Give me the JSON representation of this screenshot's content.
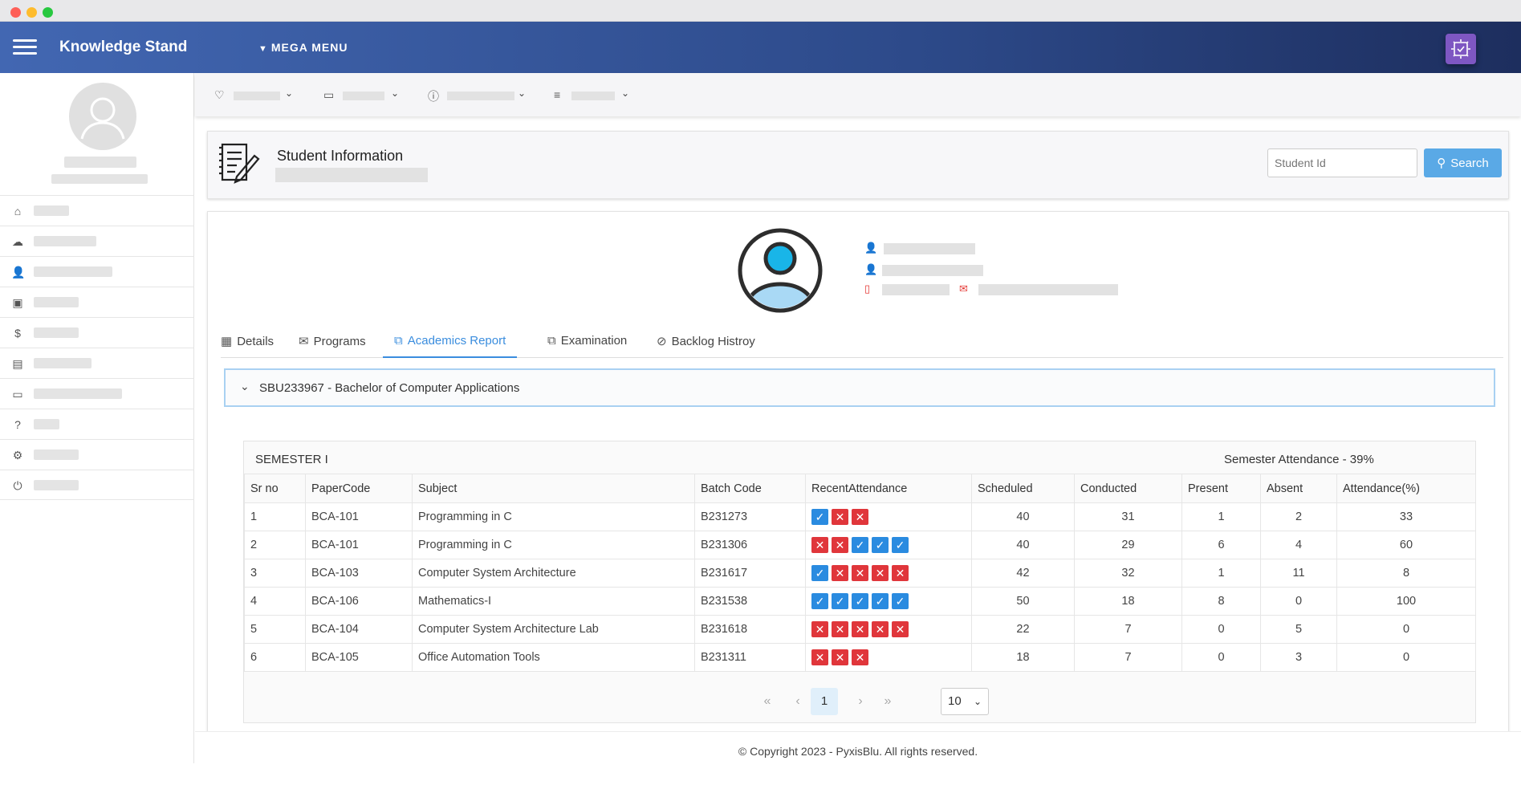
{
  "app": {
    "brand": "Knowledge Stand",
    "mega_menu": "MEGA MENU"
  },
  "header": {
    "title": "Student Information",
    "search_placeholder": "Student Id",
    "search_label": "Search"
  },
  "tabs": [
    {
      "label": "Details",
      "icon": "calendar-icon"
    },
    {
      "label": "Programs",
      "icon": "inbox-icon"
    },
    {
      "label": "Academics Report",
      "icon": "copy-icon",
      "active": true
    },
    {
      "label": "Examination",
      "icon": "copy-icon"
    },
    {
      "label": "Backlog Histroy",
      "icon": "block-icon"
    }
  ],
  "program": {
    "label": "SBU233967 - Bachelor of Computer Applications"
  },
  "semester": {
    "title": "SEMESTER I",
    "attendance": "Semester Attendance - 39%",
    "columns": [
      "Sr no",
      "PaperCode",
      "Subject",
      "Batch Code",
      "RecentAttendance",
      "Scheduled",
      "Conducted",
      "Present",
      "Absent",
      "Attendance(%)"
    ],
    "rows": [
      {
        "sr": "1",
        "code": "BCA-101",
        "subject": "Programming in C",
        "batch": "B231273",
        "recent": [
          "P",
          "A",
          "A"
        ],
        "scheduled": "40",
        "conducted": "31",
        "present": "1",
        "absent": "2",
        "percent": "33"
      },
      {
        "sr": "2",
        "code": "BCA-101",
        "subject": "Programming in C",
        "batch": "B231306",
        "recent": [
          "A",
          "A",
          "P",
          "P",
          "P"
        ],
        "scheduled": "40",
        "conducted": "29",
        "present": "6",
        "absent": "4",
        "percent": "60"
      },
      {
        "sr": "3",
        "code": "BCA-103",
        "subject": "Computer System Architecture",
        "batch": "B231617",
        "recent": [
          "P",
          "A",
          "A",
          "A",
          "A"
        ],
        "scheduled": "42",
        "conducted": "32",
        "present": "1",
        "absent": "11",
        "percent": "8"
      },
      {
        "sr": "4",
        "code": "BCA-106",
        "subject": "Mathematics-I",
        "batch": "B231538",
        "recent": [
          "P",
          "P",
          "P",
          "P",
          "P"
        ],
        "scheduled": "50",
        "conducted": "18",
        "present": "8",
        "absent": "0",
        "percent": "100"
      },
      {
        "sr": "5",
        "code": "BCA-104",
        "subject": "Computer System Architecture Lab",
        "batch": "B231618",
        "recent": [
          "A",
          "A",
          "A",
          "A",
          "A"
        ],
        "scheduled": "22",
        "conducted": "7",
        "present": "0",
        "absent": "5",
        "percent": "0"
      },
      {
        "sr": "6",
        "code": "BCA-105",
        "subject": "Office Automation Tools",
        "batch": "B231311",
        "recent": [
          "A",
          "A",
          "A"
        ],
        "scheduled": "18",
        "conducted": "7",
        "present": "0",
        "absent": "3",
        "percent": "0"
      }
    ]
  },
  "pagination": {
    "current": "1",
    "page_size": "10"
  },
  "footer": {
    "text": "© Copyright 2023 - PyxisBlu. All rights reserved."
  },
  "colors": {
    "accent": "#3a8dde",
    "present": "#2a8be0",
    "absent": "#e0363b",
    "topbar": "#2d4a8a"
  }
}
